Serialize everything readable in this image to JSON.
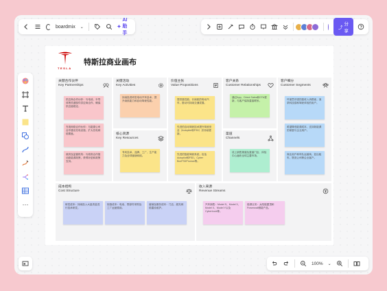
{
  "app": {
    "name": "boardmix",
    "ai_label": "AI助手",
    "share_label": "分享",
    "zoom": "100%"
  },
  "canvas": {
    "title": "特斯拉商业画布",
    "brand": "TESLA"
  },
  "sections": {
    "key_partnerships": {
      "zh": "关键合作伙伴",
      "en": "Key Partnerships",
      "notes": [
        "供应商合作伙伴：与电池、半导体等关键部件供应商合作，确保供应链稳定。",
        "充电网络合作伙伴：与能源公司合作建设充电设施，扩大充电网络覆盖。",
        "政府及监管机构：与政府合作推动新能源政策，获得补贴和政策支持。"
      ]
    },
    "key_activities": {
      "zh": "关键活动",
      "en": "Key Activities",
      "notes": [
        "持续投资研发电动汽车技术，提升续航能力和自动驾驶性能。"
      ]
    },
    "key_resources": {
      "zh": "核心资源",
      "en": "Key Resources",
      "notes": [
        "专利技术、品牌、工厂、生产能力及全球营销网络。"
      ]
    },
    "value_propositions": {
      "zh": "价值主张",
      "en": "Value Propositions",
      "notes": [
        "提供高性能、长续航的电动汽车，推动可持续交通发展。",
        "先进的自动驾驶技术提升驾驶安全（Autopilot和FSD）并持续更新。",
        "先进的智能驾驶系统，包括Autopilot和FSD，Cyber BoxFSDPromax等。"
      ]
    },
    "customer_relationships": {
      "zh": "客户关系",
      "en": "Customer Relationships",
      "notes": [
        "通过App、Direct Sales和OTA更新，与客户保持直接联系。"
      ]
    },
    "channels": {
      "zh": "渠道",
      "en": "Channels",
      "notes": [
        "线上销售渠道及直营门店、体验中心遍布全球主要市场。"
      ]
    },
    "customer_segments": {
      "zh": "客户细分",
      "en": "Customer Segments",
      "notes": [
        "环保意识强的高收入消费者，追求科技感和驾驶体验的用户。",
        "希望降低能源成本、支持新能源的家庭与企业用户。",
        "商业用户和车队运营商，如出租车、物流公司等企业客户。"
      ]
    },
    "cost_structure": {
      "zh": "成本结构",
      "en": "Cost Structure",
      "notes": [
        "研发成本：持续投入大量资金进行技术研发。",
        "制造成本：电池、零部件采购及工厂运营费用。",
        "营销及服务成本：门店、超充网络建设维护。"
      ]
    },
    "revenue_streams": {
      "zh": "收入来源",
      "en": "Revenue Streams",
      "notes": [
        "汽车销售：Model S、Model 3、Model X、Model Y以及Cybertruck等。",
        "能源业务：太阳能屋顶和Powerwall储能产品。"
      ]
    }
  }
}
